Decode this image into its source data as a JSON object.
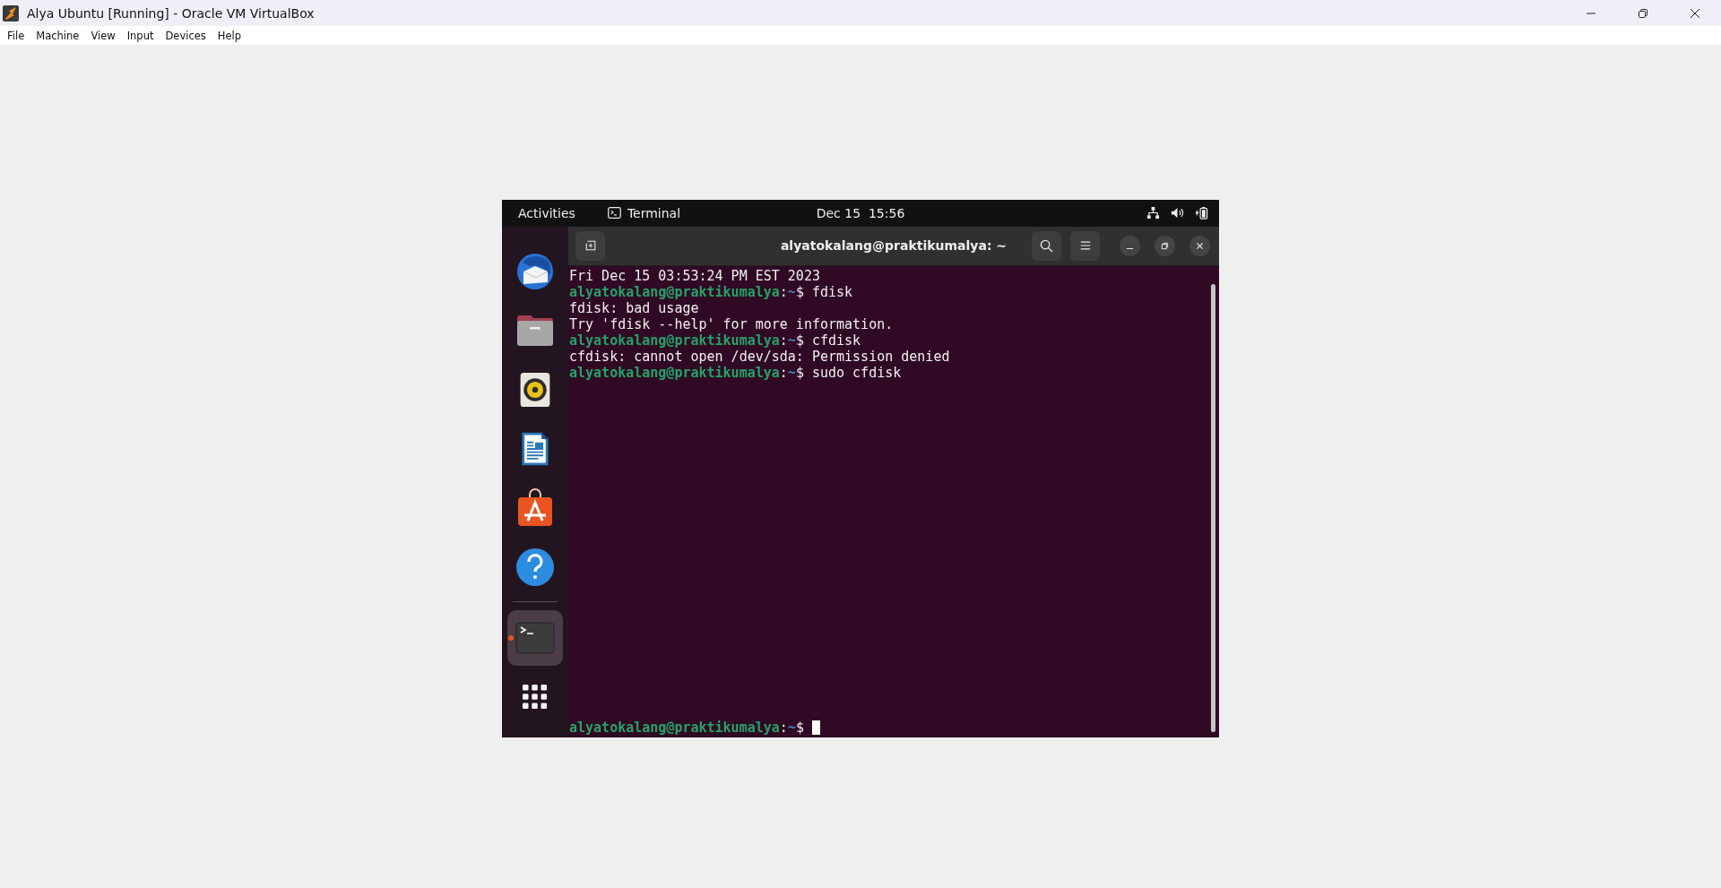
{
  "window": {
    "title": "Alya Ubuntu [Running] - Oracle VM VirtualBox"
  },
  "menu": [
    "File",
    "Machine",
    "View",
    "Input",
    "Devices",
    "Help"
  ],
  "top_bar": {
    "activities": "Activities",
    "app_menu": "Terminal",
    "clock": "Dec 15  15:56"
  },
  "dock": [
    {
      "kind": "mail",
      "selected": false,
      "running": false
    },
    {
      "kind": "files",
      "selected": false,
      "running": false
    },
    {
      "kind": "music",
      "selected": false,
      "running": false
    },
    {
      "kind": "writer",
      "selected": false,
      "running": false
    },
    {
      "kind": "store",
      "selected": false,
      "running": false
    },
    {
      "kind": "help",
      "selected": false,
      "running": false
    },
    {
      "kind": "separator"
    },
    {
      "kind": "terminal",
      "selected": true,
      "running": true
    },
    {
      "kind": "apps",
      "selected": false,
      "running": false
    }
  ],
  "terminal": {
    "title": "alyatokalang@praktikumalya: ~",
    "lines": [
      {
        "kind": "output",
        "text": "Fri Dec 15 03:53:24 PM EST 2023"
      },
      {
        "kind": "prompt",
        "user": "alyatokalang@praktikumalya",
        "separator": ":",
        "path": "~",
        "symbol": "$",
        "command": "fdisk"
      },
      {
        "kind": "output",
        "text": "fdisk: bad usage"
      },
      {
        "kind": "output",
        "text": "Try 'fdisk --help' for more information."
      },
      {
        "kind": "prompt",
        "user": "alyatokalang@praktikumalya",
        "separator": ":",
        "path": "~",
        "symbol": "$",
        "command": "cfdisk"
      },
      {
        "kind": "output",
        "text": "cfdisk: cannot open /dev/sda: Permission denied"
      },
      {
        "kind": "prompt",
        "user": "alyatokalang@praktikumalya",
        "separator": ":",
        "path": "~",
        "symbol": "$",
        "command": "sudo cfdisk"
      }
    ],
    "current_prompt": {
      "user": "alyatokalang@praktikumalya",
      "separator": ":",
      "path": "~",
      "symbol": "$"
    }
  }
}
